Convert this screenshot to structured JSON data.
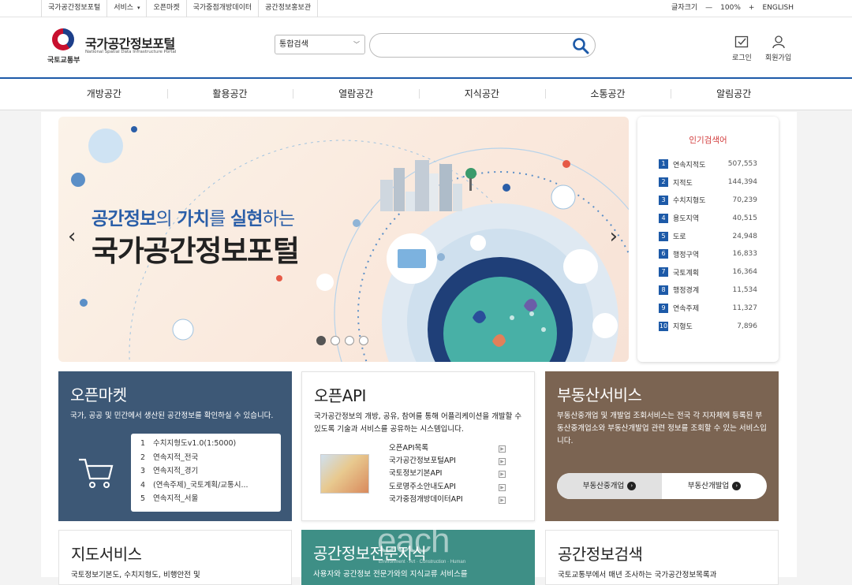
{
  "topbar": {
    "links": [
      "국가공간정보포털",
      "서비스",
      "오픈마켓",
      "국가중점개방데이터",
      "공간정보홍보관"
    ],
    "font_size_label": "글자크기",
    "zoom": "100%",
    "language": "ENGLISH"
  },
  "header": {
    "ministry": "국토교통부",
    "portal_name": "국가공간정보포털",
    "portal_sub": "National Spatial Data Infrastructure Portal",
    "search_scope": "통합검색",
    "search_placeholder": "",
    "login": "로그인",
    "signup": "회원가입"
  },
  "gnb": [
    "개방공간",
    "활용공간",
    "열람공간",
    "지식공간",
    "소통공간",
    "알림공간"
  ],
  "banner": {
    "line1_a": "공간정보",
    "line1_b": "의 ",
    "line1_c": "가치",
    "line1_d": "를 ",
    "line1_e": "실현",
    "line1_f": "하는",
    "line2": "국가공간정보포털",
    "slide_count": 4,
    "active_slide": 1
  },
  "popular": {
    "title": "인기검색어",
    "items": [
      {
        "rank": "1",
        "name": "연속지적도",
        "count": "507,553"
      },
      {
        "rank": "2",
        "name": "지적도",
        "count": "144,394"
      },
      {
        "rank": "3",
        "name": "수치지형도",
        "count": "70,239"
      },
      {
        "rank": "4",
        "name": "용도지역",
        "count": "40,515"
      },
      {
        "rank": "5",
        "name": "도로",
        "count": "24,948"
      },
      {
        "rank": "6",
        "name": "행정구역",
        "count": "16,833"
      },
      {
        "rank": "7",
        "name": "국토계획",
        "count": "16,364"
      },
      {
        "rank": "8",
        "name": "행정경계",
        "count": "11,534"
      },
      {
        "rank": "9",
        "name": "연속주제",
        "count": "11,327"
      },
      {
        "rank": "10",
        "name": "지형도",
        "count": "7,896"
      }
    ]
  },
  "openmarket": {
    "title": "오픈마켓",
    "desc": "국가, 공공 및 민간에서 생산된 공간정보를 확인하실 수 있습니다.",
    "items": [
      {
        "n": "1",
        "label": "수치지형도v1.0(1:5000)"
      },
      {
        "n": "2",
        "label": "연속지적_전국"
      },
      {
        "n": "3",
        "label": "연속지적_경기"
      },
      {
        "n": "4",
        "label": "(연속주제)_국토계획/교통시..."
      },
      {
        "n": "5",
        "label": "연속지적_서울"
      }
    ]
  },
  "openapi": {
    "title": "오픈API",
    "desc": "국가공간정보의 개방, 공유, 참여를 통해 어플리케이션을 개발할 수 있도록 기술과 서비스를 공유하는 시스템입니다.",
    "items": [
      "오픈API목록",
      "국가공간정보포털API",
      "국토정보기본API",
      "도로명주소안내도API",
      "국가중점개방데이터API"
    ]
  },
  "realestate": {
    "title": "부동산서비스",
    "desc": "부동산중개업 및 개발업 조회서비스는 전국 각 지자체에 등록된 부동산중개업소와 부동산개발업 관련 정보를 조회할 수 있는 서비스입니다.",
    "btn1": "부동산중개업",
    "btn2": "부동산개발업"
  },
  "mapservice": {
    "title": "지도서비스",
    "desc": "국토정보기본도, 수치지형도, 비행안전 및"
  },
  "expert": {
    "title": "공간정보전문지식",
    "desc": "사용자와 공간정보 전문가와의 지식교류 서비스를"
  },
  "spatialsearch": {
    "title": "공간정보검색",
    "desc": "국토교통부에서 매년 조사하는 국가공간정보목록과"
  },
  "watermark": {
    "main": "each",
    "sub": "Environment · Art · Construction · Human"
  },
  "colors": {
    "primary": "#1d5aa8",
    "openmarket": "#3d5876",
    "realestate": "#7b6452",
    "expert": "#3e8f86",
    "popular_title": "#d23b3b"
  }
}
